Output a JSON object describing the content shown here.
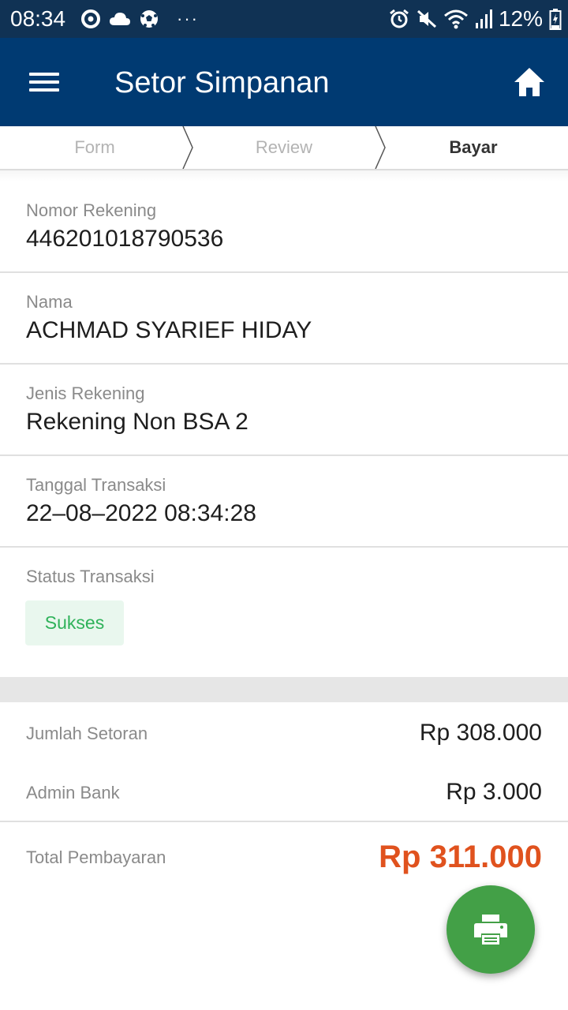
{
  "status_bar": {
    "time": "08:34",
    "battery_percent": "12%",
    "left_icons": [
      "circle-notification-icon",
      "cloud-icon",
      "soccer-ball-icon",
      "more-dots-icon"
    ],
    "right_icons": [
      "alarm-icon",
      "mute-icon",
      "wifi-icon",
      "signal-icon",
      "battery-charging-icon"
    ]
  },
  "app_bar": {
    "title": "Setor Simpanan",
    "menu_icon": "hamburger-menu-icon",
    "home_icon": "home-icon",
    "background": "#003a72"
  },
  "stepper": {
    "steps": [
      "Form",
      "Review",
      "Bayar"
    ],
    "active_step": "Bayar"
  },
  "details": [
    {
      "label": "Nomor Rekening",
      "value": "446201018790536"
    },
    {
      "label": "Nama",
      "value": "ACHMAD SYARIEF HIDAY"
    },
    {
      "label": "Jenis Rekening",
      "value": "Rekening Non BSA 2"
    },
    {
      "label": "Tanggal Transaksi",
      "value": "22–08–2022 08:34:28"
    }
  ],
  "status": {
    "label": "Status Transaksi",
    "value": "Sukses",
    "color": "#2fb25a"
  },
  "summary": {
    "deposit_label": "Jumlah Setoran",
    "deposit_value": "Rp 308.000",
    "admin_label": "Admin Bank",
    "admin_value": "Rp 3.000",
    "total_label": "Total Pembayaran",
    "total_value": "Rp 311.000",
    "total_color": "#e0521e"
  },
  "fab": {
    "icon": "printer-icon",
    "color": "#43a047"
  }
}
